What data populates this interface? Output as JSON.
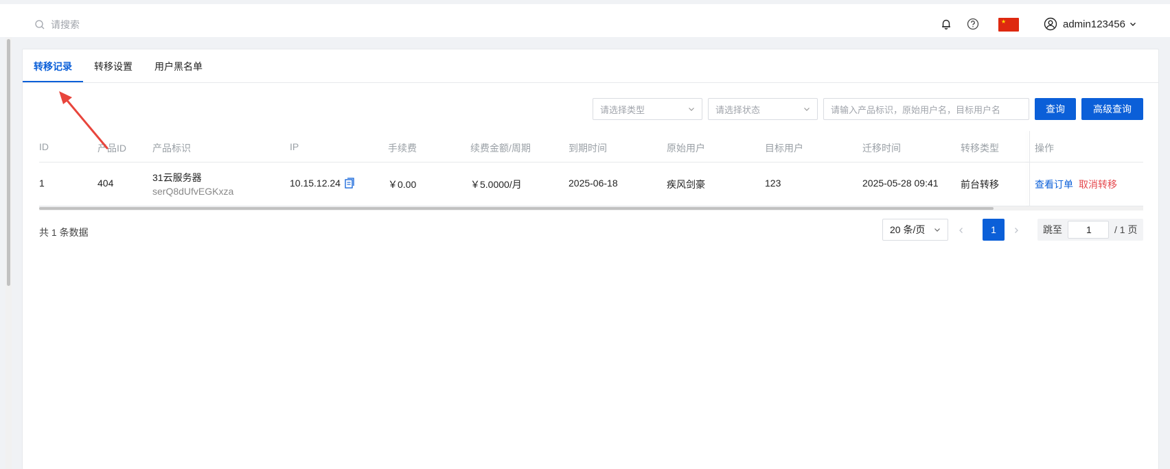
{
  "header": {
    "search_placeholder": "请搜索",
    "user_name": "admin123456",
    "icons": [
      "bell-icon",
      "help-icon",
      "china-flag-icon",
      "user-circle-icon",
      "chevron-down-icon"
    ]
  },
  "tabs": [
    {
      "label": "转移记录",
      "active": true
    },
    {
      "label": "转移设置",
      "active": false
    },
    {
      "label": "用户黑名单",
      "active": false
    }
  ],
  "filters": {
    "type_placeholder": "请选择类型",
    "status_placeholder": "请选择状态",
    "keyword_placeholder": "请输入产品标识，原始用户名，目标用户名",
    "query_label": "查询",
    "advanced_label": "高级查询"
  },
  "table": {
    "columns": [
      "ID",
      "产品ID",
      "产品标识",
      "IP",
      "手续费",
      "续费金额/周期",
      "到期时间",
      "原始用户",
      "目标用户",
      "迁移时间",
      "转移类型",
      "操作"
    ],
    "rows": [
      {
        "id": "1",
        "product_id": "404",
        "product_name": "31云服务器",
        "product_code": "serQ8dUfvEGKxza",
        "ip": "10.15.12.24",
        "fee": "￥0.00",
        "renew": "￥5.0000/月",
        "expire": "2025-06-18",
        "from_user": "疾风剑豪",
        "to_user": "123",
        "migrate_time": "2025-05-28 09:41",
        "transfer_type": "前台转移",
        "action_view": "查看订单",
        "action_cancel": "取消转移"
      }
    ]
  },
  "footer": {
    "total": "共 1 条数据",
    "page_size": "20 条/页",
    "current_page": "1",
    "jump_label": "跳至",
    "jump_value": "1",
    "total_pages": "/ 1 页"
  },
  "colors": {
    "primary": "#0b5fd8",
    "danger": "#e5484d",
    "annotation": "#e8453c"
  }
}
